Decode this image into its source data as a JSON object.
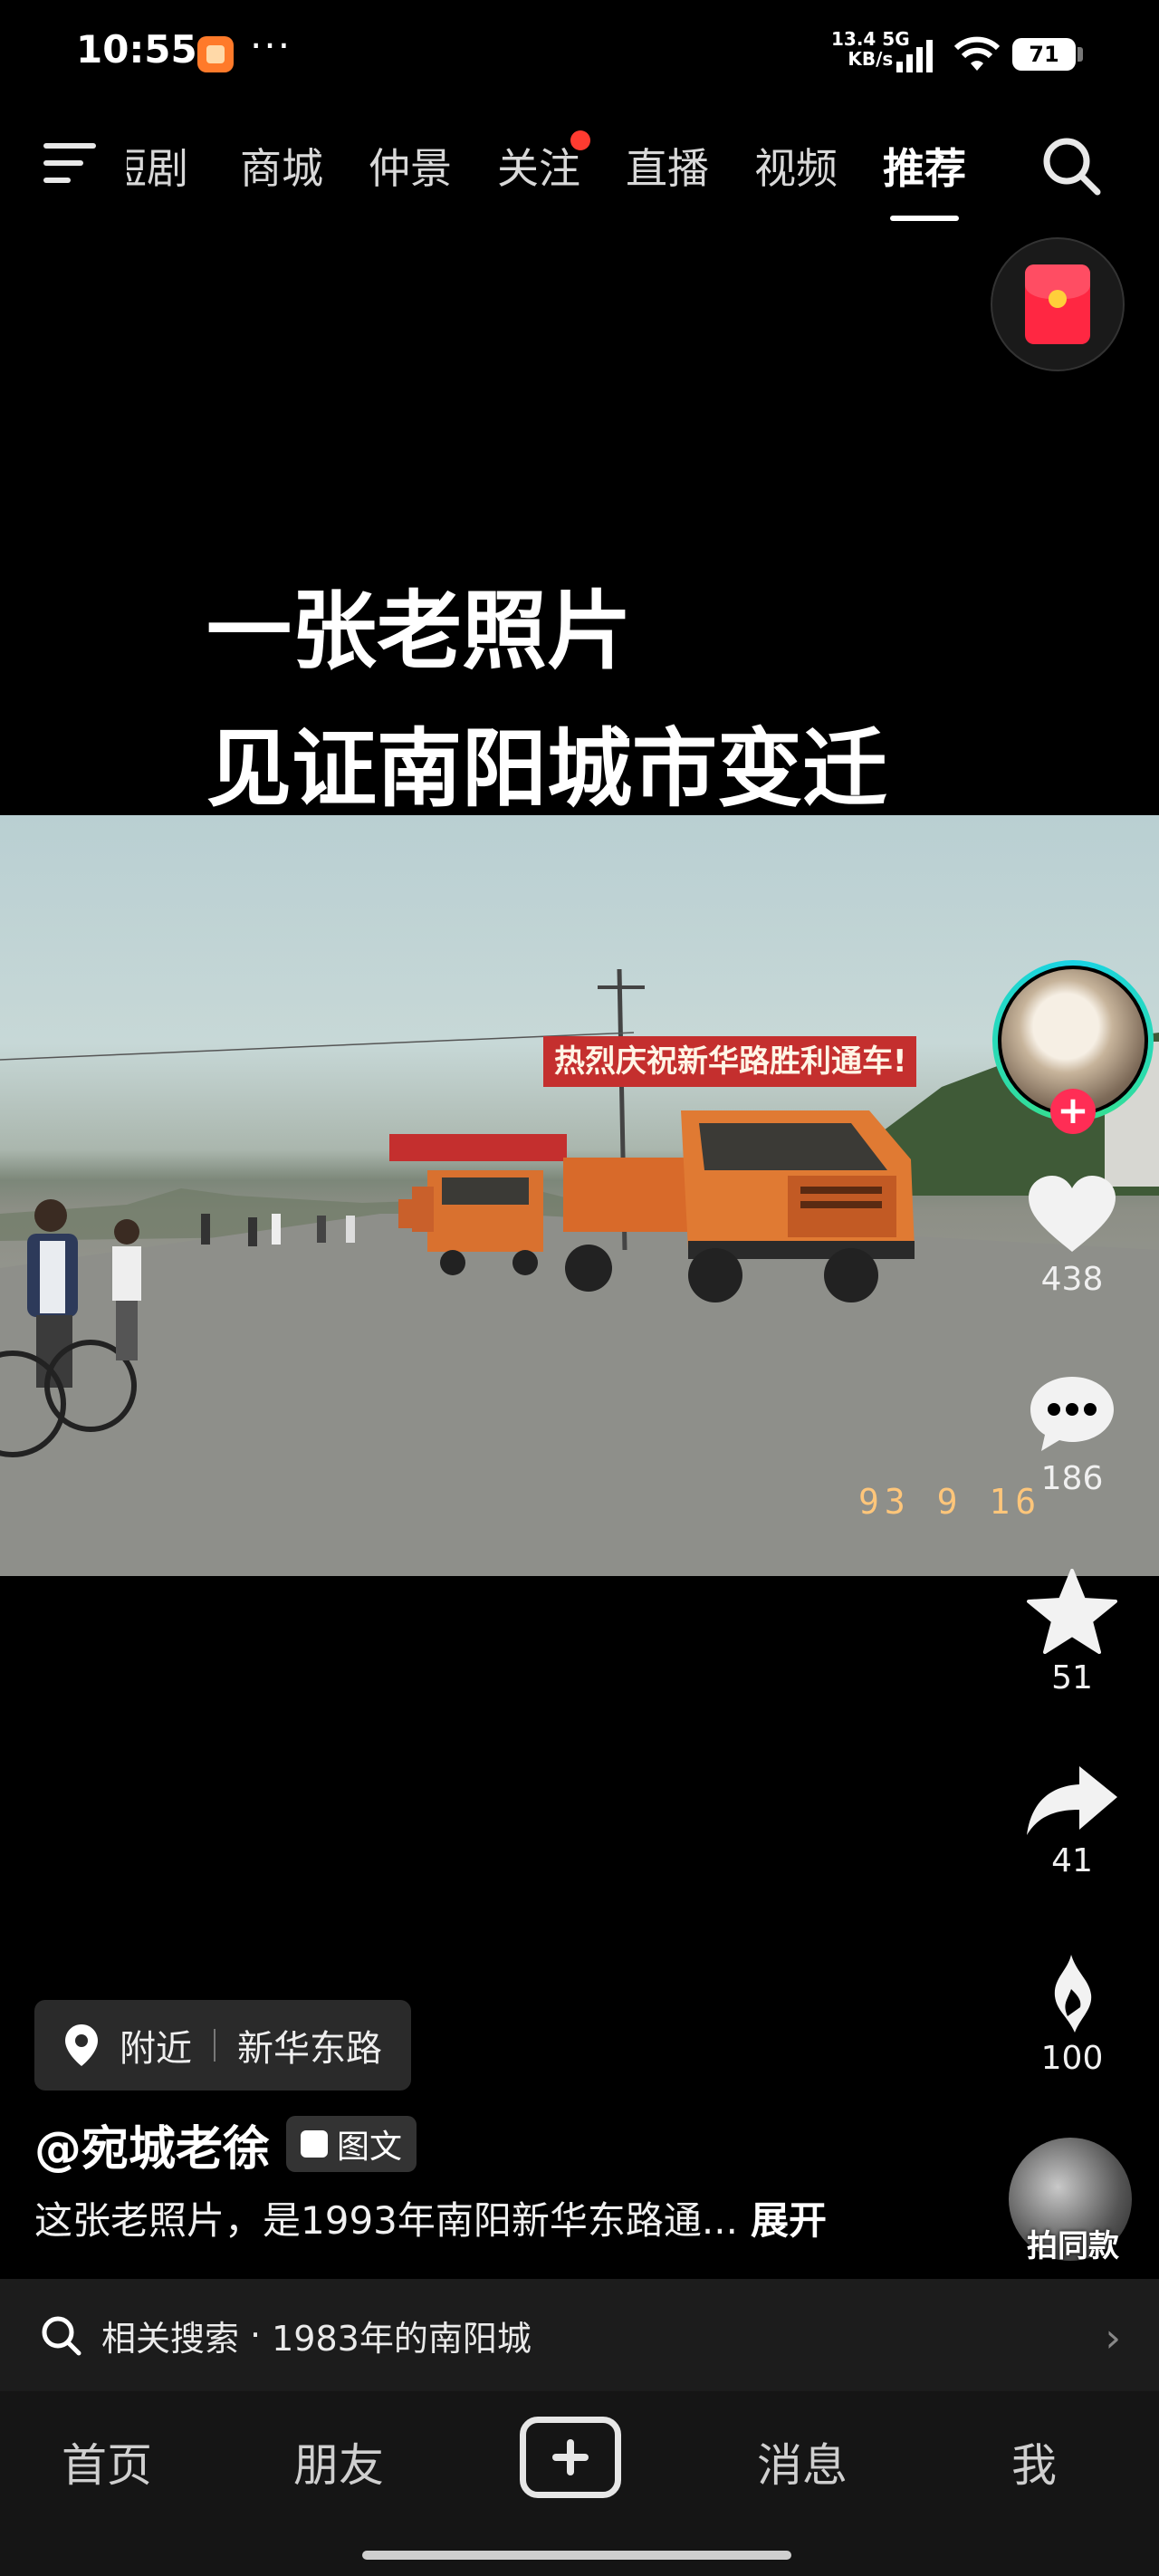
{
  "status_bar": {
    "time": "10:55",
    "more": "···",
    "net_speed_value": "13.4 5G",
    "net_speed_unit": "KB/s",
    "battery": "71"
  },
  "top_nav": {
    "tabs": [
      "短剧",
      "商城",
      "仲景",
      "关注",
      "直播",
      "视频",
      "推荐"
    ],
    "active_tab": "推荐",
    "notification_dot_tab": "关注"
  },
  "video": {
    "caption_line1": "一张老照片",
    "caption_line2": "见证南阳城市变迁",
    "photo_banner": "热烈庆祝新华路胜利通车!",
    "photo_date": "93 9 16"
  },
  "rail": {
    "likes": "438",
    "comments": "186",
    "favorites": "51",
    "shares": "41",
    "gifts": "100",
    "same_style_label": "拍同款"
  },
  "post": {
    "location_nearby": "附近",
    "location_name": "新华东路",
    "author": "@宛城老徐",
    "tag": "图文",
    "description": "这张老照片，是1993年南阳新华东路通...",
    "expand": "展开"
  },
  "related_search": {
    "prefix": "相关搜索",
    "dot": "·",
    "query": "1983年的南阳城"
  },
  "bottom_nav": {
    "home": "首页",
    "friends": "朋友",
    "messages": "消息",
    "me": "我"
  },
  "colors": {
    "background": "#000000",
    "accent_red": "#ff2d55",
    "avatar_ring": "#19d3e6"
  }
}
